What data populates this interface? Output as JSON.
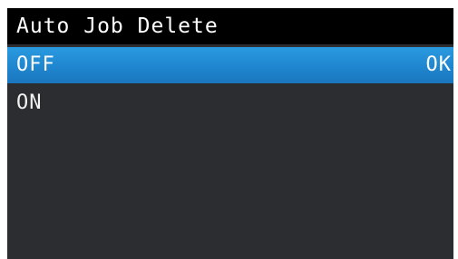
{
  "screen": {
    "title": "Auto Job Delete",
    "items": [
      {
        "label": "OFF",
        "action_label": "OK",
        "selected": true
      },
      {
        "label": "ON",
        "action_label": "",
        "selected": false
      }
    ]
  },
  "colors": {
    "title_background": "#000000",
    "panel_background": "#2b2d31",
    "selection_highlight": "#1f86d0",
    "text": "#ffffff"
  }
}
